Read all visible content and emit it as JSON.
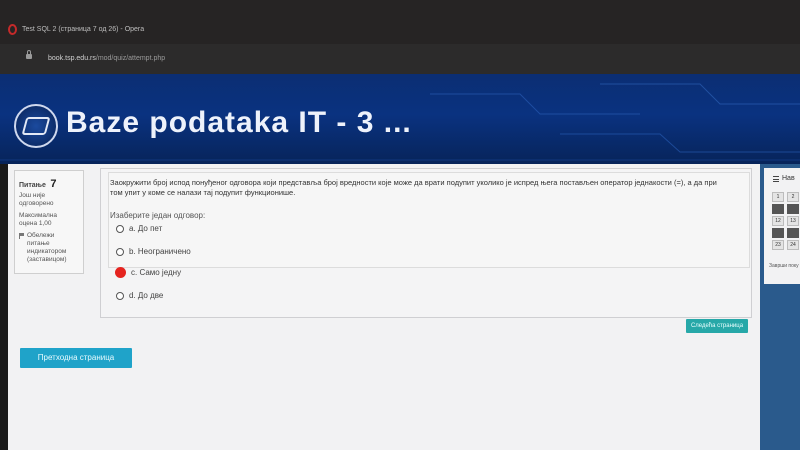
{
  "browser": {
    "window_title": "Test SQL 2 (страница 7 од 26) - Opera",
    "url_host": "book.tsp.edu.rs",
    "url_path": "/mod/quiz/attempt.php"
  },
  "site": {
    "title": "Baze podataka IT - 3 ..."
  },
  "question_info": {
    "label": "Питање",
    "number": "7",
    "status_line1": "Још није",
    "status_line2": "одговорено",
    "mark_line1": "Максимална",
    "mark_line2": "оцена 1,00",
    "flag_line1": "Обележи",
    "flag_line2": "питање",
    "flag_line3": "индикатором",
    "flag_line4": "(заставицом)"
  },
  "question": {
    "text_line1": "Заокружити број испод понуђеног одговора који представља број вредности које може да врати подупит уколико је испред њега постављен оператор једнакости (=), а да при",
    "text_line2": "том упит у коме се налази тај подупит функционише.",
    "prompt": "Изаберите један одговор:",
    "options": [
      {
        "label": "a. До пет"
      },
      {
        "label": "b. Неограничено"
      },
      {
        "label": "c. Само једну"
      },
      {
        "label": "d. До две"
      }
    ]
  },
  "buttons": {
    "next": "Следећа страница",
    "prev": "Претходна страница"
  },
  "navigation": {
    "title": "Нав",
    "cells": [
      "1",
      "2",
      "",
      "",
      "12",
      "13",
      "",
      "",
      "23",
      "24"
    ],
    "end_text": "Заврши поку"
  }
}
